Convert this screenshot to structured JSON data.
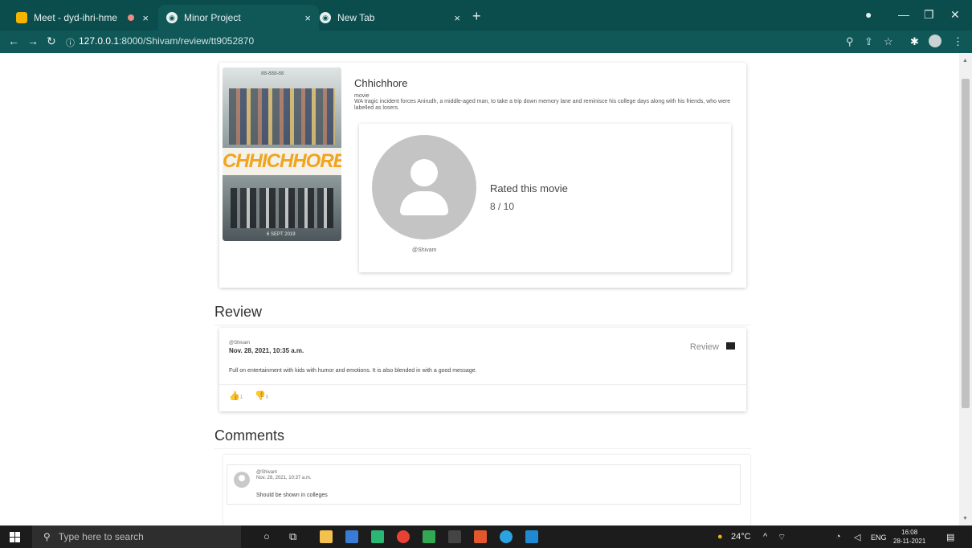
{
  "browser": {
    "tabs": [
      {
        "title": "Meet - dyd-ihri-hme"
      },
      {
        "title": "Minor Project"
      },
      {
        "title": "New Tab"
      }
    ],
    "close_glyph": "×",
    "new_tab_glyph": "+",
    "url_host": "127.0.0.1",
    "url_path": ":8000/Shivam/review/tt9052870"
  },
  "movie": {
    "poster_top_text": "ठठ-ठठठ-ठठ",
    "poster_logo": "CHHICHHORE",
    "poster_bottom_text": "6 SEPT 2019",
    "title": "Chhichhore",
    "type": "movie",
    "description": "WA tragic incident forces Anirudh, a middle-aged man, to take a trip down memory lane and reminisce his college days along with his friends, who were labelled as losers."
  },
  "rating": {
    "label": "Rated this movie",
    "value": "8 / 10",
    "user": "@Shivam"
  },
  "review_section": {
    "title": "Review",
    "user": "@Shivam",
    "date": "Nov. 28, 2021, 10:35 a.m.",
    "tag": "Review",
    "text": "Full on entertainment with kids with humor and emotions. It is also blended in with a good message.",
    "likes": "1",
    "dislikes": "0"
  },
  "comments_section": {
    "title": "Comments",
    "items": [
      {
        "user": "@Shivam",
        "date": "Nov. 28, 2021, 10:37 a.m.",
        "text": "Should be shown in colleges"
      }
    ]
  },
  "taskbar": {
    "search_placeholder": "Type here to search",
    "weather": "24°C",
    "language": "ENG",
    "time": "16:08",
    "date": "28-11-2021"
  },
  "colors": {
    "chrome_dark": "#0b4d4d",
    "chrome_toolbar": "#105757",
    "accent_orange": "#f0a030",
    "avatar_gray": "#c4c4c4"
  }
}
